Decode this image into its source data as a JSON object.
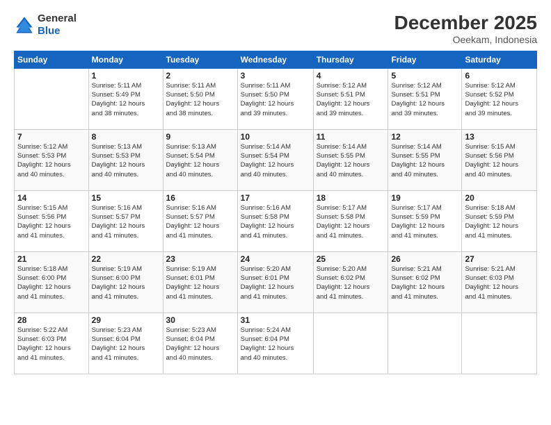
{
  "logo": {
    "line1": "General",
    "line2": "Blue"
  },
  "title": "December 2025",
  "subtitle": "Oeekam, Indonesia",
  "weekdays": [
    "Sunday",
    "Monday",
    "Tuesday",
    "Wednesday",
    "Thursday",
    "Friday",
    "Saturday"
  ],
  "weeks": [
    [
      {
        "day": "",
        "info": ""
      },
      {
        "day": "1",
        "info": "Sunrise: 5:11 AM\nSunset: 5:49 PM\nDaylight: 12 hours\nand 38 minutes."
      },
      {
        "day": "2",
        "info": "Sunrise: 5:11 AM\nSunset: 5:50 PM\nDaylight: 12 hours\nand 38 minutes."
      },
      {
        "day": "3",
        "info": "Sunrise: 5:11 AM\nSunset: 5:50 PM\nDaylight: 12 hours\nand 39 minutes."
      },
      {
        "day": "4",
        "info": "Sunrise: 5:12 AM\nSunset: 5:51 PM\nDaylight: 12 hours\nand 39 minutes."
      },
      {
        "day": "5",
        "info": "Sunrise: 5:12 AM\nSunset: 5:51 PM\nDaylight: 12 hours\nand 39 minutes."
      },
      {
        "day": "6",
        "info": "Sunrise: 5:12 AM\nSunset: 5:52 PM\nDaylight: 12 hours\nand 39 minutes."
      }
    ],
    [
      {
        "day": "7",
        "info": "Sunrise: 5:12 AM\nSunset: 5:53 PM\nDaylight: 12 hours\nand 40 minutes."
      },
      {
        "day": "8",
        "info": "Sunrise: 5:13 AM\nSunset: 5:53 PM\nDaylight: 12 hours\nand 40 minutes."
      },
      {
        "day": "9",
        "info": "Sunrise: 5:13 AM\nSunset: 5:54 PM\nDaylight: 12 hours\nand 40 minutes."
      },
      {
        "day": "10",
        "info": "Sunrise: 5:14 AM\nSunset: 5:54 PM\nDaylight: 12 hours\nand 40 minutes."
      },
      {
        "day": "11",
        "info": "Sunrise: 5:14 AM\nSunset: 5:55 PM\nDaylight: 12 hours\nand 40 minutes."
      },
      {
        "day": "12",
        "info": "Sunrise: 5:14 AM\nSunset: 5:55 PM\nDaylight: 12 hours\nand 40 minutes."
      },
      {
        "day": "13",
        "info": "Sunrise: 5:15 AM\nSunset: 5:56 PM\nDaylight: 12 hours\nand 40 minutes."
      }
    ],
    [
      {
        "day": "14",
        "info": "Sunrise: 5:15 AM\nSunset: 5:56 PM\nDaylight: 12 hours\nand 41 minutes."
      },
      {
        "day": "15",
        "info": "Sunrise: 5:16 AM\nSunset: 5:57 PM\nDaylight: 12 hours\nand 41 minutes."
      },
      {
        "day": "16",
        "info": "Sunrise: 5:16 AM\nSunset: 5:57 PM\nDaylight: 12 hours\nand 41 minutes."
      },
      {
        "day": "17",
        "info": "Sunrise: 5:16 AM\nSunset: 5:58 PM\nDaylight: 12 hours\nand 41 minutes."
      },
      {
        "day": "18",
        "info": "Sunrise: 5:17 AM\nSunset: 5:58 PM\nDaylight: 12 hours\nand 41 minutes."
      },
      {
        "day": "19",
        "info": "Sunrise: 5:17 AM\nSunset: 5:59 PM\nDaylight: 12 hours\nand 41 minutes."
      },
      {
        "day": "20",
        "info": "Sunrise: 5:18 AM\nSunset: 5:59 PM\nDaylight: 12 hours\nand 41 minutes."
      }
    ],
    [
      {
        "day": "21",
        "info": "Sunrise: 5:18 AM\nSunset: 6:00 PM\nDaylight: 12 hours\nand 41 minutes."
      },
      {
        "day": "22",
        "info": "Sunrise: 5:19 AM\nSunset: 6:00 PM\nDaylight: 12 hours\nand 41 minutes."
      },
      {
        "day": "23",
        "info": "Sunrise: 5:19 AM\nSunset: 6:01 PM\nDaylight: 12 hours\nand 41 minutes."
      },
      {
        "day": "24",
        "info": "Sunrise: 5:20 AM\nSunset: 6:01 PM\nDaylight: 12 hours\nand 41 minutes."
      },
      {
        "day": "25",
        "info": "Sunrise: 5:20 AM\nSunset: 6:02 PM\nDaylight: 12 hours\nand 41 minutes."
      },
      {
        "day": "26",
        "info": "Sunrise: 5:21 AM\nSunset: 6:02 PM\nDaylight: 12 hours\nand 41 minutes."
      },
      {
        "day": "27",
        "info": "Sunrise: 5:21 AM\nSunset: 6:03 PM\nDaylight: 12 hours\nand 41 minutes."
      }
    ],
    [
      {
        "day": "28",
        "info": "Sunrise: 5:22 AM\nSunset: 6:03 PM\nDaylight: 12 hours\nand 41 minutes."
      },
      {
        "day": "29",
        "info": "Sunrise: 5:23 AM\nSunset: 6:04 PM\nDaylight: 12 hours\nand 41 minutes."
      },
      {
        "day": "30",
        "info": "Sunrise: 5:23 AM\nSunset: 6:04 PM\nDaylight: 12 hours\nand 40 minutes."
      },
      {
        "day": "31",
        "info": "Sunrise: 5:24 AM\nSunset: 6:04 PM\nDaylight: 12 hours\nand 40 minutes."
      },
      {
        "day": "",
        "info": ""
      },
      {
        "day": "",
        "info": ""
      },
      {
        "day": "",
        "info": ""
      }
    ]
  ]
}
